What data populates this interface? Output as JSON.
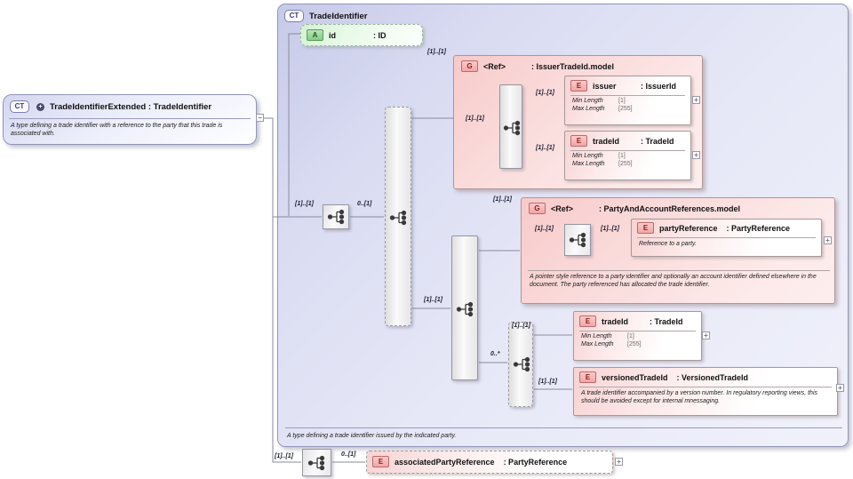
{
  "icons": {
    "complex_type": "CT",
    "attribute": "A",
    "group": "G",
    "element": "E",
    "expand": "+",
    "collapse": "−"
  },
  "labels": {
    "one_to_one": "[1]..[1]",
    "zero_to_one": "0..[1]",
    "zero_to_many": "0..*"
  },
  "extended_box": {
    "title": "TradeIdentifierExtended : TradeIdentifier",
    "description": "A type defining a trade identifier with a reference to the party that this trade is associated with."
  },
  "main_box": {
    "title": "TradeIdentifier",
    "footer": "A type defining a trade identifier issued by the indicated party."
  },
  "attribute_id": {
    "name": "id",
    "type": ": ID"
  },
  "groups": {
    "issuer_trade_id": {
      "name": "<Ref>",
      "type": ": IssuerTradeId.model"
    },
    "party_and_account": {
      "name": "<Ref>",
      "type": ": PartyAndAccountReferences.model",
      "description": "A pointer style reference to a party identifier and optionally an account identifier defined elsewhere in the document. The party referenced has allocated the trade identifier."
    }
  },
  "elements": {
    "issuer": {
      "name": "issuer",
      "type": ": IssuerId",
      "facets": [
        [
          "Min Length",
          "[1]"
        ],
        [
          "Max Length",
          "[255]"
        ]
      ]
    },
    "trade_id_1": {
      "name": "tradeId",
      "type": ": TradeId",
      "facets": [
        [
          "Min Length",
          "[1]"
        ],
        [
          "Max Length",
          "[255]"
        ]
      ]
    },
    "party_reference": {
      "name": "partyReference",
      "type": ": PartyReference",
      "description": "Reference to a party."
    },
    "trade_id_2": {
      "name": "tradeId",
      "type": ": TradeId",
      "facets": [
        [
          "Min Length",
          "[1]"
        ],
        [
          "Max Length",
          "[255]"
        ]
      ]
    },
    "versioned_trade_id": {
      "name": "versionedTradeId",
      "type": ": VersionedTradeId",
      "description": "A trade identifier accompanied by a version number. In regulatory reporting views, this should be avoided except for internal mnessaging."
    },
    "associated_party_reference": {
      "name": "associatedPartyReference",
      "type": ": PartyReference"
    }
  }
}
